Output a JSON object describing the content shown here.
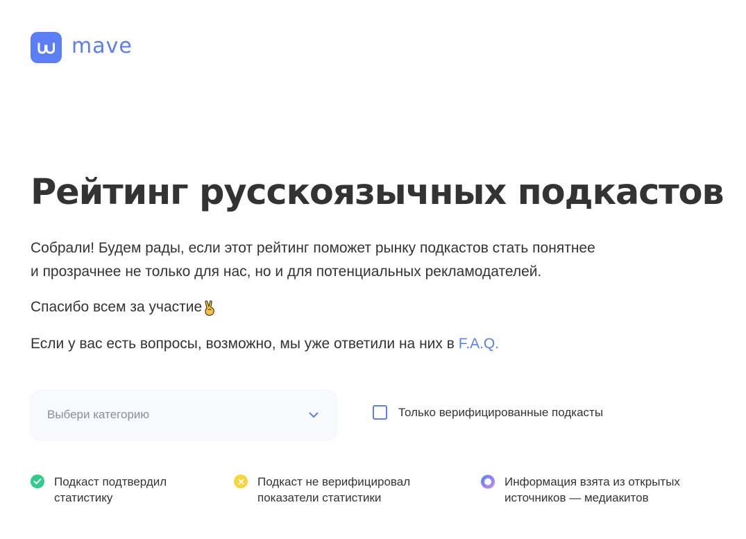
{
  "brand": {
    "name": "mave",
    "color": "#5b7ef5"
  },
  "page": {
    "title": "Рейтинг русскоязычных подкастов",
    "intro_line1": "Собрали! Будем рады, если этот рейтинг поможет рынку подкастов стать понятнее",
    "intro_line2": "и прозрачнее не только для нас, но и для потенциальных рекламодателей.",
    "thanks": "Спасибо всем за участие",
    "thanks_icon": "victory-hand-icon",
    "faq_prefix": "Если у вас есть вопросы, возможно, мы уже ответили на них в ",
    "faq_link": "F.A.Q."
  },
  "filters": {
    "category_placeholder": "Выбери категорию",
    "verified_only_label": "Только верифицированные подкасты",
    "verified_only_checked": false
  },
  "legend": [
    {
      "icon": "check-circle-icon",
      "color": "#2fcc8b",
      "text": "Подкаст подтвердил\nстатистику"
    },
    {
      "icon": "cross-circle-icon",
      "color": "#f5d63d",
      "text": "Подкаст не верифицировал\nпоказатели статистики"
    },
    {
      "icon": "ring-circle-icon",
      "color": "#6a7ff0",
      "text": "Информация взята из открытых\nисточников — медиакитов"
    }
  ]
}
